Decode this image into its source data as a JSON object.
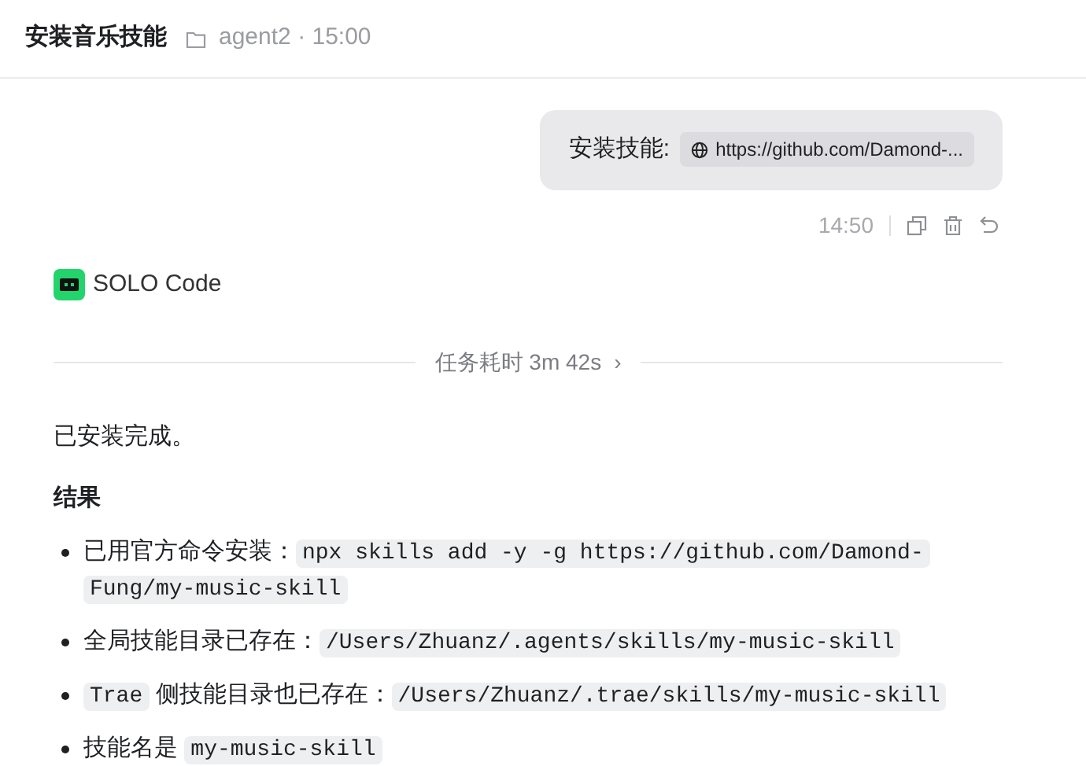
{
  "header": {
    "title": "安装音乐技能",
    "folder": "agent2",
    "separator": "·",
    "time": "15:00"
  },
  "user_message": {
    "label": "安装技能:",
    "link": "https://github.com/Damond-...",
    "time": "14:50"
  },
  "agent": {
    "name": "SOLO Code"
  },
  "duration": {
    "text": "任务耗时 3m 42s",
    "chevron": "›"
  },
  "response": {
    "intro": "已安装完成。",
    "heading": "结果",
    "bullets": [
      [
        {
          "kind": "text",
          "text": "已用官方命令安装："
        },
        {
          "kind": "code",
          "text": "npx skills add -y -g https://github.com/Damond-Fung/my-music-skill"
        }
      ],
      [
        {
          "kind": "text",
          "text": "全局技能目录已存在："
        },
        {
          "kind": "code",
          "text": "/Users/Zhuanz/.agents/skills/my-music-skill"
        }
      ],
      [
        {
          "kind": "code",
          "text": "Trae"
        },
        {
          "kind": "text",
          "text": " 侧技能目录也已存在："
        },
        {
          "kind": "code",
          "text": "/Users/Zhuanz/.trae/skills/my-music-skill"
        }
      ],
      [
        {
          "kind": "text",
          "text": "技能名是 "
        },
        {
          "kind": "code",
          "text": "my-music-skill"
        }
      ]
    ]
  }
}
